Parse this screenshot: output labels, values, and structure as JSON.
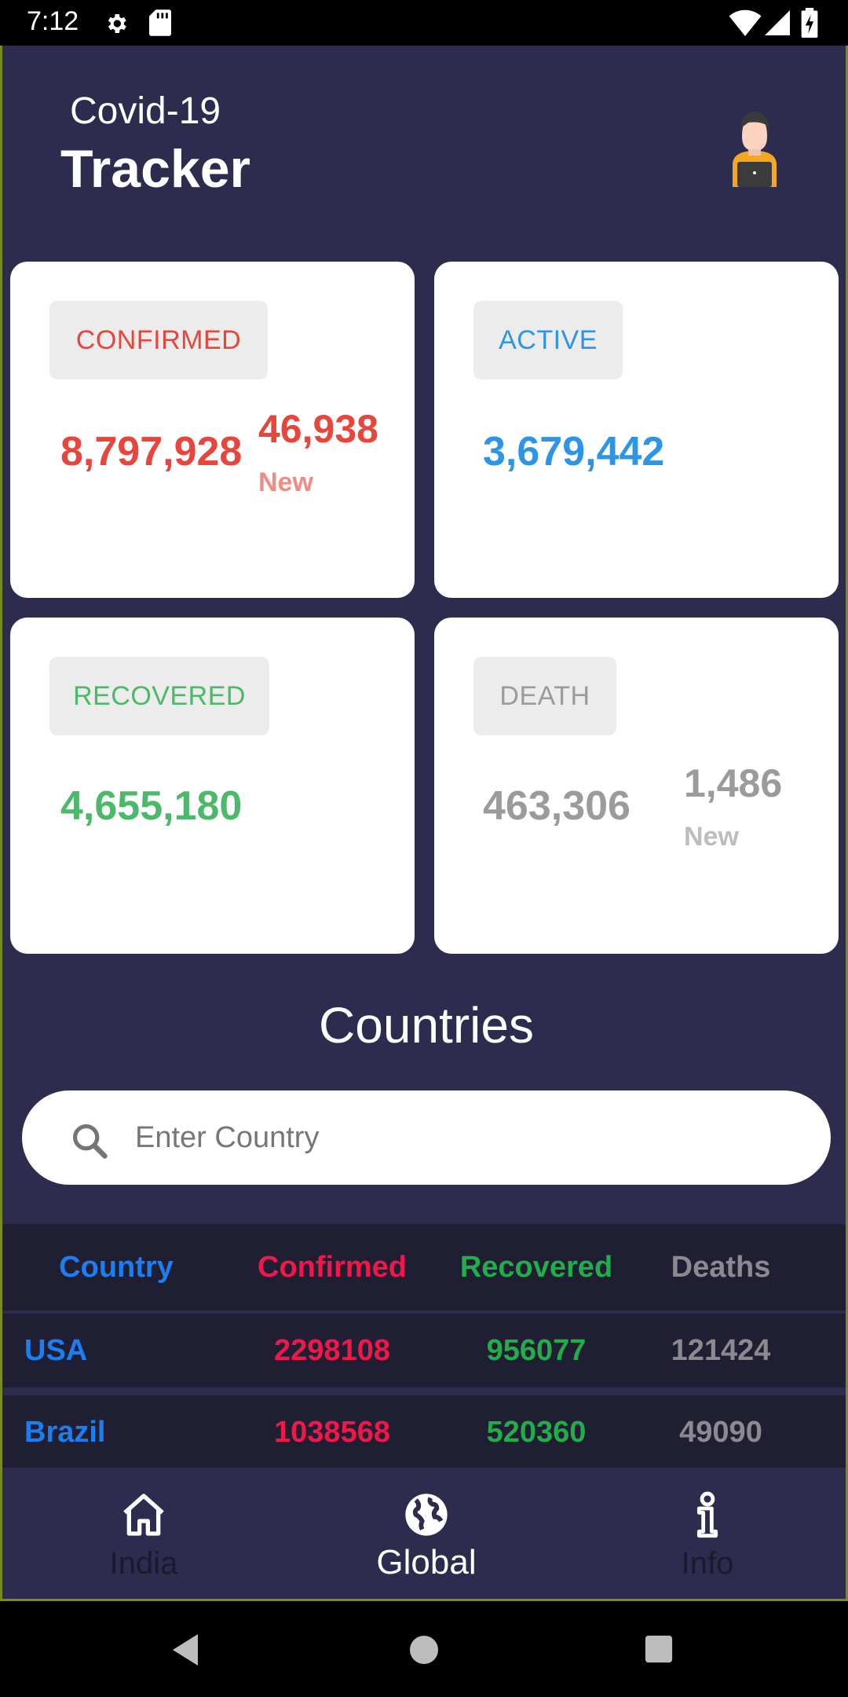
{
  "status_bar": {
    "time": "7:12"
  },
  "header": {
    "title_small": "Covid-19",
    "title_big": "Tracker"
  },
  "cards": {
    "confirmed": {
      "label": "CONFIRMED",
      "total": "8,797,928",
      "new": "46,938",
      "new_label": "New"
    },
    "active": {
      "label": "ACTIVE",
      "total": "3,679,442"
    },
    "recovered": {
      "label": "RECOVERED",
      "total": "4,655,180"
    },
    "death": {
      "label": "DEATH",
      "total": "463,306",
      "new": "1,486",
      "new_label": "New"
    }
  },
  "countries": {
    "title": "Countries",
    "search": {
      "placeholder": "Enter Country",
      "value": ""
    },
    "columns": [
      "Country",
      "Confirmed",
      "Recovered",
      "Deaths"
    ],
    "rows": [
      [
        "USA",
        "2298108",
        "956077",
        "121424"
      ],
      [
        "Brazil",
        "1038568",
        "520360",
        "49090"
      ]
    ]
  },
  "bottom_nav": {
    "items": [
      {
        "label": "India",
        "icon": "home-icon",
        "active": false
      },
      {
        "label": "Global",
        "icon": "globe-icon",
        "active": true
      },
      {
        "label": "Info",
        "icon": "info-icon",
        "active": false
      }
    ]
  },
  "colors": {
    "background": "#2d2b4e",
    "confirmed": "#e8453c",
    "confirmed_new_label": "#f28b84",
    "active": "#2d95e8",
    "recovered": "#4cb86a",
    "death": "#9b9b9b",
    "death_new_label": "#bdbdbd",
    "table_country": "#1a7ff2",
    "table_confirmed": "#f0184a",
    "table_recovered": "#22ad4a",
    "table_deaths": "#8a8a90"
  }
}
